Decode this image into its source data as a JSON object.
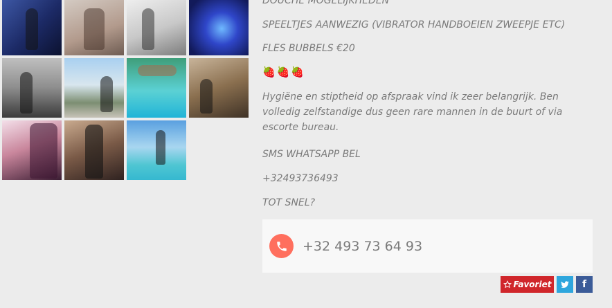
{
  "gallery": {
    "thumbnails": [
      "photo 1",
      "photo 2",
      "photo 3",
      "photo 4",
      "photo 5",
      "photo 6",
      "photo 7",
      "photo 8",
      "photo 9",
      "photo 10",
      "photo 11"
    ]
  },
  "description": {
    "line_top": "DOUCHE MOGELIJKHEDEN",
    "line_toys": "SPEELTJES AANWEZIG (VIBRATOR HANDBOEIEN ZWEEPJE ETC)",
    "line_bubbles": "FLES BUBBELS €20",
    "emojis": "🍓🍓🍓",
    "paragraph": "Hygiëne en stiptheid op afspraak vind ik zeer belangrijk. Ben volledig zelfstandige dus geen rare mannen in de buurt of via escorte bureau.",
    "line_contact": "SMS WHATSAPP BEL",
    "line_phone": "+32493736493",
    "line_bye": "TOT SNEL?"
  },
  "contact": {
    "phone": "+32 493 73 64 93",
    "icon": "phone-icon"
  },
  "actions": {
    "favorite_label": "Favoriet",
    "twitter_label": "t",
    "facebook_label": "f"
  },
  "colors": {
    "accent_red": "#d0262b",
    "phone_icon_bg": "#ff6f5e",
    "twitter": "#2ea6dd",
    "facebook": "#3b5b98",
    "text": "#7b7b7b",
    "background": "#ececec"
  }
}
